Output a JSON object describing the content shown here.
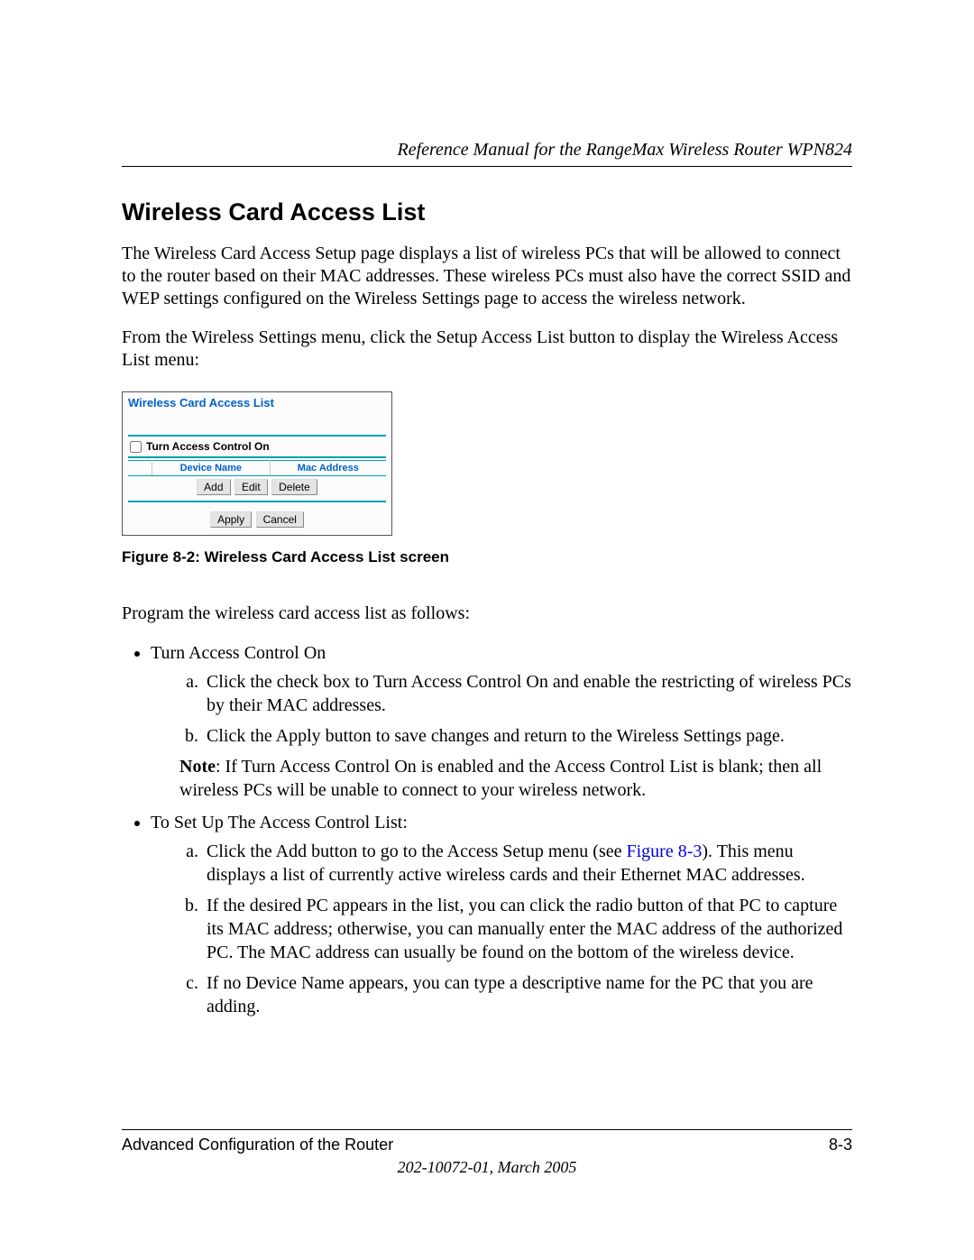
{
  "header": {
    "manual_title": "Reference Manual for the RangeMax Wireless Router WPN824"
  },
  "section": {
    "title": "Wireless Card Access List",
    "para1": "The Wireless Card Access Setup page displays a list of wireless PCs that will be allowed to connect to the router based on their MAC addresses. These wireless PCs must also have the correct SSID and WEP settings configured on the Wireless Settings page to access the wireless network.",
    "para2": "From the Wireless Settings menu, click the Setup Access List button to display the Wireless Access List menu:"
  },
  "ui": {
    "panel_title": "Wireless Card Access List",
    "checkbox_label": "Turn Access Control On",
    "col_device": "Device Name",
    "col_mac": "Mac Address",
    "btn_add": "Add",
    "btn_edit": "Edit",
    "btn_delete": "Delete",
    "btn_apply": "Apply",
    "btn_cancel": "Cancel"
  },
  "figure": {
    "caption": "Figure 8-2:  Wireless Card Access List screen"
  },
  "instructions": {
    "intro": "Program the wireless card access list as follows:",
    "bullet1": "Turn Access Control On",
    "b1_a": "Click the check box to Turn Access Control On and enable the restricting of wireless PCs by their MAC addresses.",
    "b1_b": "Click the Apply button to save changes and return to the Wireless Settings page.",
    "note_label": "Note",
    "note_text": ": If Turn Access Control On is enabled and the Access Control List is blank; then all wireless PCs will be unable to connect to your wireless network.",
    "bullet2": "To Set Up The Access Control List:",
    "b2_a_pre": "Click the Add button to go to the Access Setup menu (see ",
    "b2_a_ref": "Figure 8-3",
    "b2_a_post": "). This menu displays a list of currently active wireless cards and their Ethernet MAC addresses.",
    "b2_b": "If the desired PC appears in the list, you can click the radio button of that PC to capture its MAC address; otherwise, you can manually enter the MAC address of the authorized PC. The MAC address can usually be found on the bottom of the wireless device.",
    "b2_c": "If no Device Name appears, you can type a descriptive name for the PC that you are adding."
  },
  "footer": {
    "left": "Advanced Configuration of the Router",
    "right": "8-3",
    "docid": "202-10072-01, March 2005"
  }
}
